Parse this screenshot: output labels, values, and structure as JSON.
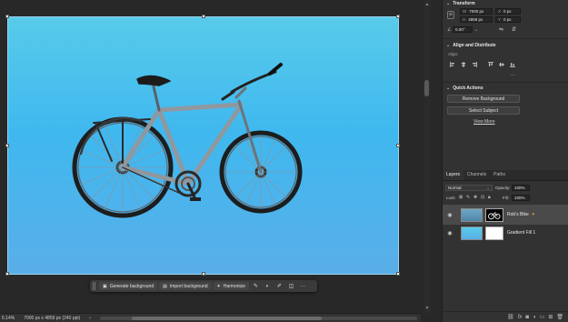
{
  "canvas": {
    "context_bar": {
      "generate_background": "Generate background",
      "import_background": "Import background",
      "harmonize": "Harmonize",
      "more": "···"
    }
  },
  "status_bar": {
    "zoom": "5.14%",
    "doc_info": "7000 px x 4859 px (240 ppi)"
  },
  "properties": {
    "transform": {
      "title": "Transform",
      "width_label": "W",
      "width_value": "7000 px",
      "height_label": "H",
      "height_value": "4859 px",
      "x_label": "X",
      "x_value": "0 px",
      "y_label": "Y",
      "y_value": "0 px",
      "angle_value": "0.00°"
    },
    "align": {
      "title": "Align and Distribute",
      "align_label": "Align:"
    },
    "quick_actions": {
      "title": "Quick Actions",
      "remove_background": "Remove Background",
      "select_subject": "Select Subject",
      "view_more": "View More"
    }
  },
  "layers": {
    "tabs": [
      "Layers",
      "Channels",
      "Paths"
    ],
    "blend_mode": "Normal",
    "opacity_label": "Opacity:",
    "opacity_value": "100%",
    "lock_label": "Lock:",
    "fill_label": "Fill:",
    "fill_value": "100%",
    "rows": [
      {
        "name": "Rob's Bike"
      },
      {
        "name": "Gradient Fill 1"
      }
    ],
    "bottom_icons": [
      "link-icon",
      "fx-icon",
      "mask-icon",
      "adjustment-icon",
      "group-icon",
      "new-layer-icon",
      "trash-icon"
    ]
  },
  "colors": {
    "gradient_top": "#58cbea",
    "gradient_bottom": "#5aaee8",
    "panel_bg": "#323232",
    "app_bg": "#282828",
    "selected_layer": "#4a4a4a",
    "accent": "#1473e6"
  }
}
